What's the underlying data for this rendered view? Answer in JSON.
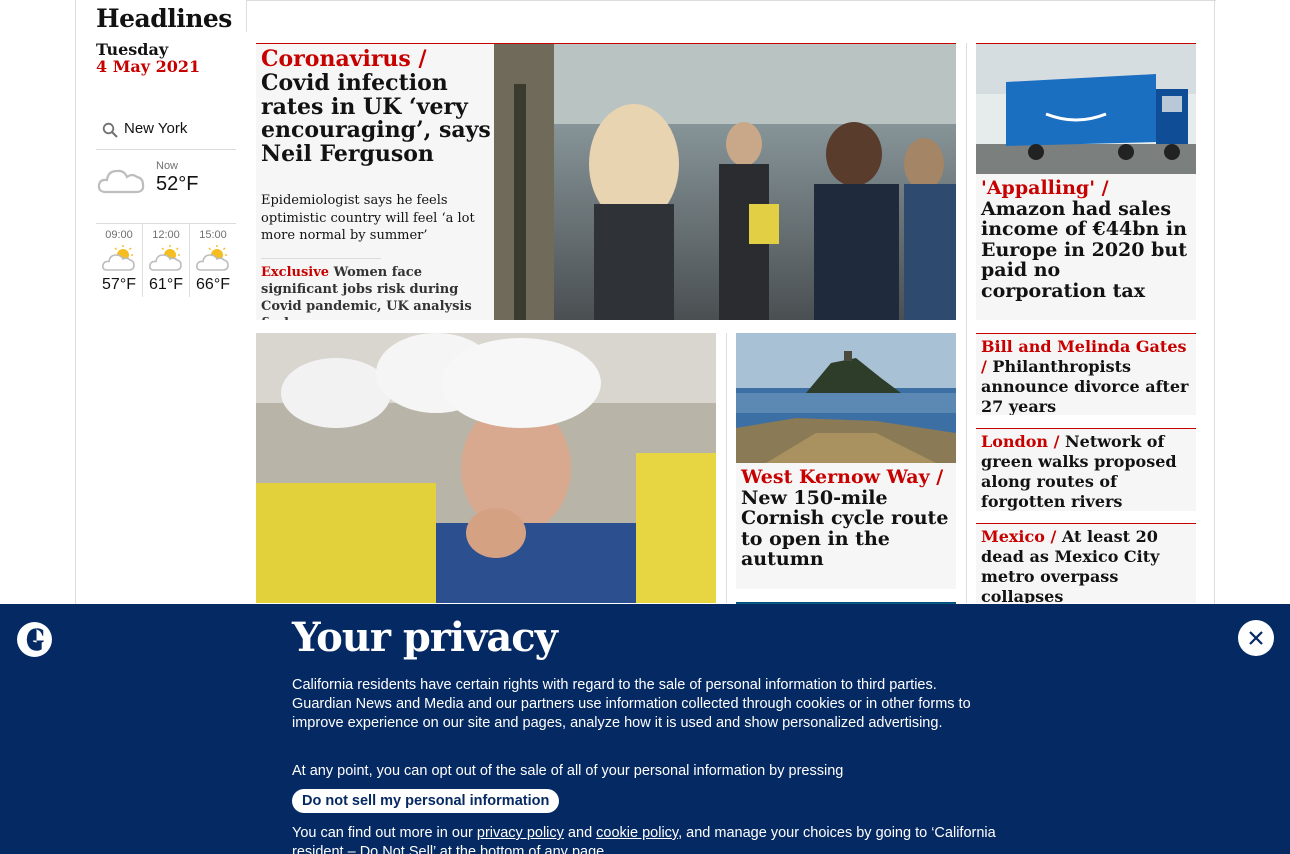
{
  "sidebar": {
    "title": "Headlines",
    "day": "Tuesday",
    "date": "4 May 2021",
    "weather": {
      "location": "New York",
      "now_label": "Now",
      "now_temp": "52°F",
      "now_icon": "cloudy-icon",
      "forecast": [
        {
          "time": "09:00",
          "temp": "57°F",
          "icon": "sun-behind-cloud-icon"
        },
        {
          "time": "12:00",
          "temp": "61°F",
          "icon": "sun-behind-cloud-icon"
        },
        {
          "time": "15:00",
          "temp": "66°F",
          "icon": "sun-behind-cloud-icon"
        }
      ]
    }
  },
  "stories": {
    "main": {
      "kicker": "Coronavirus /",
      "headline": " Covid infection rates in UK ‘very encouraging’, says Neil Ferguson",
      "standfirst": "Epidemiologist says he feels optimistic country will feel ‘a lot more normal by summer’",
      "sublink_kicker": "Exclusive",
      "sublink_text": " Women face significant jobs risk during Covid pandemic, UK analysis finds"
    },
    "amazon": {
      "kicker": "'Appalling' /",
      "headline": " Amazon had sales income of €44bn in Europe in 2020 but paid no corporation tax"
    },
    "kernow": {
      "kicker": "West Kernow Way /",
      "headline": " New 150-mile Cornish cycle route to open in the autumn"
    },
    "gates": {
      "kicker": "Bill and Melinda Gates /",
      "headline": " Philanthropists announce divorce after 27 years"
    },
    "london": {
      "kicker": "London /",
      "headline": " Network of green walks proposed along routes of forgotten rivers"
    },
    "mexico": {
      "kicker": "Mexico /",
      "headline": " At least 20 dead as Mexico City metro overpass collapses"
    }
  },
  "privacy": {
    "title": "Your privacy",
    "body1": "California residents have certain rights with regard to the sale of personal information to third parties. Guardian News and Media and our partners use information collected through cookies or in other forms to improve experience on our site and pages, analyze how it is used and show personalized advertising.",
    "body2": "At any point, you can opt out of the sale of all of your personal information by pressing",
    "button": "Do not sell my personal information",
    "body3_pre": "You can find out more in our ",
    "privacy_link": "privacy policy",
    "body3_and": " and ",
    "cookie_link": "cookie policy",
    "body3_post": ", and manage your choices by going to ‘California resident – Do Not Sell’ at the bottom of any page."
  },
  "colors": {
    "accent": "#c70000",
    "banner": "#052962",
    "panel": "#f6f6f6"
  }
}
